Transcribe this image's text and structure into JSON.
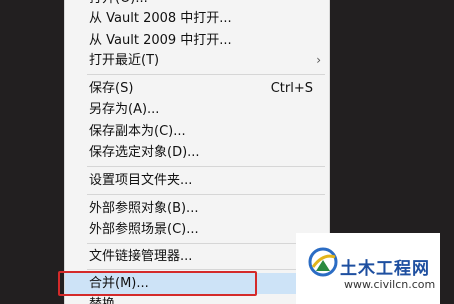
{
  "menu": {
    "items": [
      {
        "label": "打开(O)...",
        "shortcut": "",
        "submenu": false
      },
      {
        "label": "从 Vault 2008 中打开...",
        "shortcut": "",
        "submenu": false
      },
      {
        "label": "从 Vault 2009 中打开...",
        "shortcut": "",
        "submenu": false
      },
      {
        "label": "打开最近(T)",
        "shortcut": "",
        "submenu": true
      },
      {
        "label": "保存(S)",
        "shortcut": "Ctrl+S",
        "submenu": false
      },
      {
        "label": "另存为(A)...",
        "shortcut": "",
        "submenu": false
      },
      {
        "label": "保存副本为(C)...",
        "shortcut": "",
        "submenu": false
      },
      {
        "label": "保存选定对象(D)...",
        "shortcut": "",
        "submenu": false
      },
      {
        "label": "设置项目文件夹...",
        "shortcut": "",
        "submenu": false
      },
      {
        "label": "外部参照对象(B)...",
        "shortcut": "",
        "submenu": false
      },
      {
        "label": "外部参照场景(C)...",
        "shortcut": "",
        "submenu": false
      },
      {
        "label": "文件链接管理器...",
        "shortcut": "",
        "submenu": false
      },
      {
        "label": "合并(M)...",
        "shortcut": "",
        "submenu": false
      },
      {
        "label": "替换...",
        "shortcut": "",
        "submenu": false
      }
    ],
    "submenu_arrow": "›",
    "highlighted_item": "合并(M)..."
  },
  "watermark": {
    "site_name": "土木工程网",
    "url": "www.civilcn.com",
    "logo_icon": "civilcn-logo-icon"
  },
  "colors": {
    "background": "#221f20",
    "menu_bg": "#f4f4f4",
    "highlight": "#cde3f7",
    "annotation_box": "#d42a2a",
    "watermark_text": "#1e4fa0"
  }
}
